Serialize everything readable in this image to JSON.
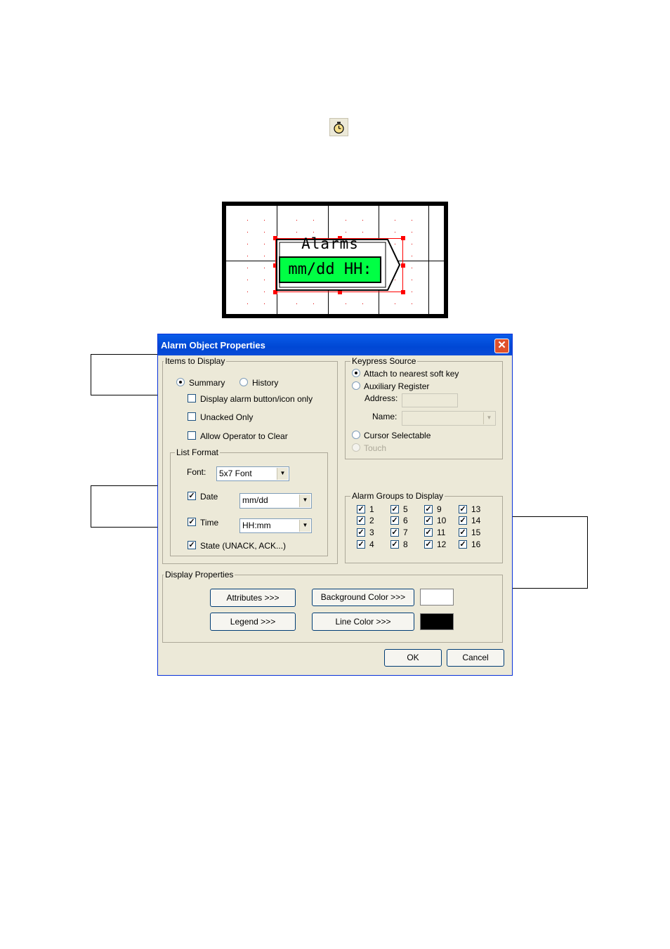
{
  "toolbar_icon": "alarm-clock-icon",
  "preview": {
    "object_title": "Alarms",
    "object_field": "mm/dd HH:",
    "field_color": "#00ff44"
  },
  "dialog": {
    "title": "Alarm Object Properties",
    "close_symbol": "✕",
    "items_to_display": {
      "group_label": "Items to Display",
      "summary_label": "Summary",
      "history_label": "History",
      "display_button_only_label": "Display alarm button/icon only",
      "unacked_only_label": "Unacked Only",
      "allow_clear_label": "Allow Operator to Clear",
      "list_format": {
        "group_label": "List Format",
        "font_label": "Font:",
        "font_value": "5x7 Font",
        "date_label": "Date",
        "date_value": "mm/dd",
        "time_label": "Time",
        "time_value": "HH:mm",
        "state_label": "State (UNACK, ACK...)"
      }
    },
    "keypress_source": {
      "group_label": "Keypress Source",
      "attach_label": "Attach to nearest soft key",
      "aux_label": "Auxiliary Register",
      "address_label": "Address:",
      "name_label": "Name:",
      "cursor_label": "Cursor Selectable",
      "touch_label": "Touch"
    },
    "alarm_groups": {
      "group_label": "Alarm Groups to Display",
      "items": [
        "1",
        "2",
        "3",
        "4",
        "5",
        "6",
        "7",
        "8",
        "9",
        "10",
        "11",
        "12",
        "13",
        "14",
        "15",
        "16"
      ]
    },
    "display_properties": {
      "group_label": "Display Properties",
      "attributes_button": "Attributes >>>",
      "legend_button": "Legend >>>",
      "background_color_button": "Background Color >>>",
      "line_color_button": "Line Color >>>",
      "background_color": "#ffffff",
      "line_color": "#000000"
    },
    "ok_button": "OK",
    "cancel_button": "Cancel",
    "check_mark": "✓"
  }
}
